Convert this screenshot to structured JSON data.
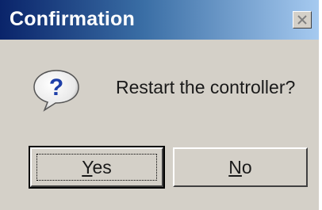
{
  "dialog": {
    "title": "Confirmation",
    "message": "Restart the controller?",
    "icon": "question-icon"
  },
  "buttons": {
    "yes_label": "Yes",
    "no_label": "No"
  },
  "colors": {
    "titlebar_start": "#0a246a",
    "titlebar_end": "#a6caf0",
    "dialog_face": "#d4d0c8"
  }
}
